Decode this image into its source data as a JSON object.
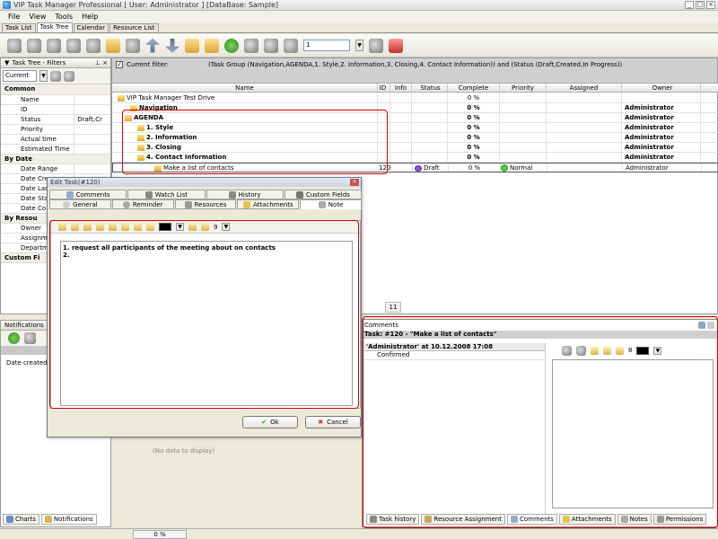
{
  "window": {
    "title": "VIP Task Manager Professional [ User: Administrator ] [DataBase: Sample]"
  },
  "menu": [
    "File",
    "View",
    "Tools",
    "Help"
  ],
  "view_tabs": [
    "Task List",
    "Task Tree",
    "Calendar",
    "Resource List"
  ],
  "toolbar": {
    "page_value": "1"
  },
  "filters_panel": {
    "title": "Task Tree - Filters",
    "current": "Current",
    "rows": [
      {
        "section": "Common"
      },
      {
        "label": "Name",
        "value": ""
      },
      {
        "label": "ID",
        "value": ""
      },
      {
        "label": "Status",
        "value": "Draft,Cr"
      },
      {
        "label": "Priority",
        "value": ""
      },
      {
        "label": "Actual time",
        "value": ""
      },
      {
        "label": "Estimated Time",
        "value": ""
      },
      {
        "section": "By Date"
      },
      {
        "label": "Date Range",
        "value": ""
      },
      {
        "label": "Date Cre",
        "value": ""
      },
      {
        "label": "Date Las",
        "value": ""
      },
      {
        "label": "Date Sta",
        "value": ""
      },
      {
        "label": "Date Co",
        "value": ""
      },
      {
        "section": "By Resou"
      },
      {
        "label": "Owner",
        "value": ""
      },
      {
        "label": "Assignme",
        "value": ""
      },
      {
        "label": "Departme",
        "value": ""
      },
      {
        "section": "Custom Fi"
      }
    ]
  },
  "notifications": {
    "title": "Notifications",
    "date_created_label": "Date created:",
    "no_data": "(No data to display)"
  },
  "bottom_tabs": [
    "Charts",
    "Notifications"
  ],
  "grid": {
    "current_filter_label": "Current filter:",
    "current_filter": "(Task Group  (Navigation,AGENDA,1. Style,2. Information,3. Closing,4. Contact Information)) and (Status  (Draft,Created,In Progress))",
    "columns": [
      "Name",
      "ID",
      "Info",
      "Status",
      "Complete",
      "Priority",
      "Assigned",
      "Owner"
    ],
    "rows": [
      {
        "name": "VIP Task Manager Test Drive",
        "id": "",
        "status": "",
        "complete": "0 %",
        "priority": "",
        "owner": ""
      },
      {
        "name": "Navigation",
        "id": "",
        "status": "",
        "complete": "0 %",
        "priority": "",
        "owner": "Administrator"
      },
      {
        "name": "AGENDA",
        "id": "",
        "status": "",
        "complete": "0 %",
        "priority": "",
        "owner": "Administrator"
      },
      {
        "name": "1. Style",
        "id": "",
        "status": "",
        "complete": "0 %",
        "priority": "",
        "owner": "Administrator"
      },
      {
        "name": "2. Information",
        "id": "",
        "status": "",
        "complete": "0 %",
        "priority": "",
        "owner": "Administrator"
      },
      {
        "name": "3. Closing",
        "id": "",
        "status": "",
        "complete": "0 %",
        "priority": "",
        "owner": "Administrator"
      },
      {
        "name": "4. Contact Information",
        "id": "",
        "status": "",
        "complete": "0 %",
        "priority": "",
        "owner": "Administrator"
      },
      {
        "name": "Make a list of contacts",
        "id": "120",
        "status": "Draft",
        "complete": "0 %",
        "priority": "Normal",
        "owner": "Administrator"
      }
    ],
    "count": "11"
  },
  "comments": {
    "title": "Comments",
    "task_header": "Task: #120 - \"Make a list of contacts\"",
    "author_line": "'Administrator' at 10.12.2008 17:08",
    "comment_text": "Confirmed",
    "font_size": "8",
    "tabs": [
      "Task history",
      "Resource Assignment",
      "Comments",
      "Attachments",
      "Notes",
      "Permissions"
    ]
  },
  "edit_dialog": {
    "title": "Edit Task(#120)",
    "tabs_row1": [
      "Comments",
      "Watch List",
      "History",
      "Custom Fields"
    ],
    "tabs_row2": [
      "General",
      "Reminder",
      "Resources",
      "Attachments",
      "Note"
    ],
    "font_size": "9",
    "note_line1": "1. request all participants of the meeting about on contacts",
    "note_line2": "2.",
    "ok_label": "Ok",
    "cancel_label": "Cancel"
  },
  "statusbar": {
    "progress": "0 %"
  }
}
